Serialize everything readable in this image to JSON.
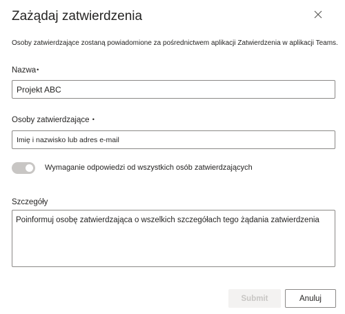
{
  "dialog": {
    "title": "Zażądaj zatwierdzenia",
    "description": "Osoby zatwierdzające zostaną powiadomione za pośrednictwem aplikacji Zatwierdzenia w aplikacji Teams."
  },
  "name_field": {
    "label": "Nazwa",
    "required_mark": "•",
    "value": "Projekt ABC"
  },
  "approvers_field": {
    "label": "Osoby zatwierdzające",
    "required_mark": "•",
    "placeholder": "Imię i nazwisko lub adres e-mail"
  },
  "require_all": {
    "label": "Wymaganie odpowiedzi od wszystkich osób zatwierdzających",
    "enabled": false
  },
  "details_field": {
    "label": "Szczegóły",
    "placeholder": "Poinformuj osobę zatwierdzająca o wszelkich szczegółach tego żądania zatwierdzenia"
  },
  "buttons": {
    "submit": "Submit",
    "cancel": "Anuluj"
  },
  "icons": {
    "close": "close-icon"
  }
}
